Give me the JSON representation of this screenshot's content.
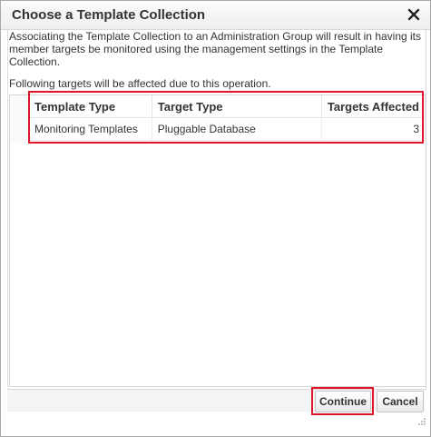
{
  "dialog": {
    "title": "Choose a Template Collection",
    "close_icon": "close-icon"
  },
  "body": {
    "description": "Associating the Template Collection to an Administration Group will result in having its member targets be monitored using the management settings in the Template Collection.",
    "affected_text": "Following targets will be affected due to this operation."
  },
  "table": {
    "columns": [
      "Template Type",
      "Target Type",
      "Targets Affected"
    ],
    "rows": [
      {
        "template_type": "Monitoring Templates",
        "target_type": "Pluggable Database",
        "targets_affected": "3"
      }
    ]
  },
  "footer": {
    "continue_label": "Continue",
    "cancel_label": "Cancel"
  },
  "colors": {
    "highlight": "#e0142c",
    "border": "#a9a9a9"
  }
}
